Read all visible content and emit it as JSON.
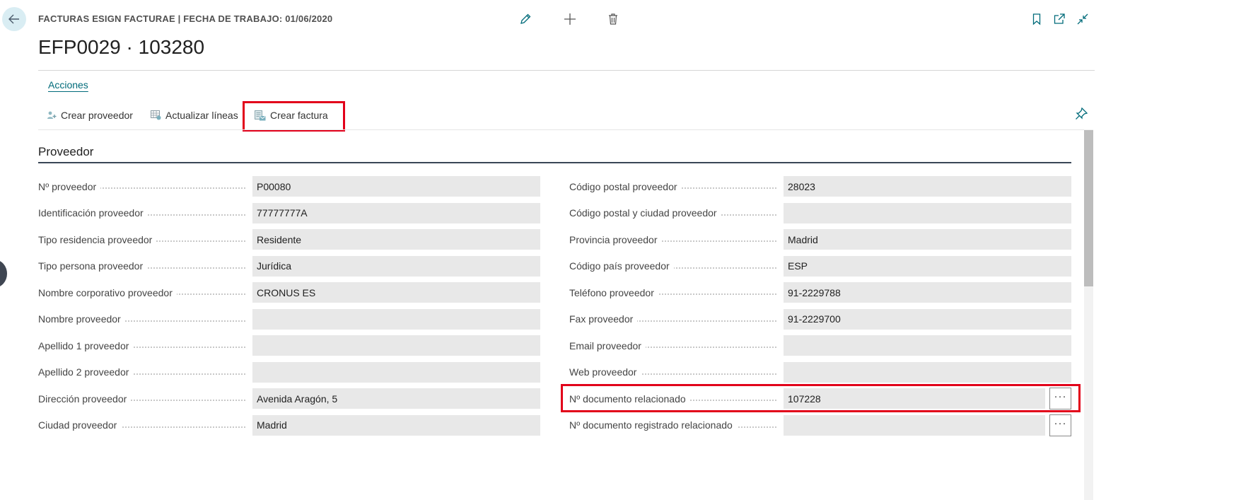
{
  "header": {
    "caption": "FACTURAS ESIGN FACTURAE | FECHA DE TRABAJO: 01/06/2020",
    "title": "EFP0029 · 103280"
  },
  "tabs": {
    "actions_label": "Acciones"
  },
  "actions": [
    {
      "label": "Crear proveedor",
      "icon": "create-vendor-icon"
    },
    {
      "label": "Actualizar líneas",
      "icon": "update-lines-icon"
    },
    {
      "label": "Crear factura",
      "icon": "create-invoice-icon"
    }
  ],
  "section": {
    "title": "Proveedor"
  },
  "left_fields": [
    {
      "label": "Nº proveedor",
      "value": "P00080"
    },
    {
      "label": "Identificación proveedor",
      "value": "77777777A"
    },
    {
      "label": "Tipo residencia proveedor",
      "value": "Residente"
    },
    {
      "label": "Tipo persona proveedor",
      "value": "Jurídica"
    },
    {
      "label": "Nombre corporativo proveedor",
      "value": "CRONUS ES"
    },
    {
      "label": "Nombre proveedor",
      "value": ""
    },
    {
      "label": "Apellido 1 proveedor",
      "value": ""
    },
    {
      "label": "Apellido 2 proveedor",
      "value": ""
    },
    {
      "label": "Dirección proveedor",
      "value": "Avenida Aragón, 5"
    },
    {
      "label": "Ciudad proveedor",
      "value": "Madrid"
    }
  ],
  "right_fields": [
    {
      "label": "Código postal proveedor",
      "value": "28023"
    },
    {
      "label": "Código postal y ciudad proveedor",
      "value": ""
    },
    {
      "label": "Provincia proveedor",
      "value": "Madrid"
    },
    {
      "label": "Código país proveedor",
      "value": "ESP"
    },
    {
      "label": "Teléfono proveedor",
      "value": "91-2229788"
    },
    {
      "label": "Fax proveedor",
      "value": "91-2229700"
    },
    {
      "label": "Email proveedor",
      "value": ""
    },
    {
      "label": "Web proveedor",
      "value": ""
    },
    {
      "label": "Nº documento relacionado",
      "value": "107228",
      "lookup": "···"
    },
    {
      "label": "Nº documento registrado relacionado",
      "value": "",
      "lookup": "···"
    }
  ],
  "colors": {
    "accent": "#006b7a",
    "highlight": "#e2001a",
    "field_background": "#e8e8e8",
    "section_rule": "#3a4656"
  }
}
